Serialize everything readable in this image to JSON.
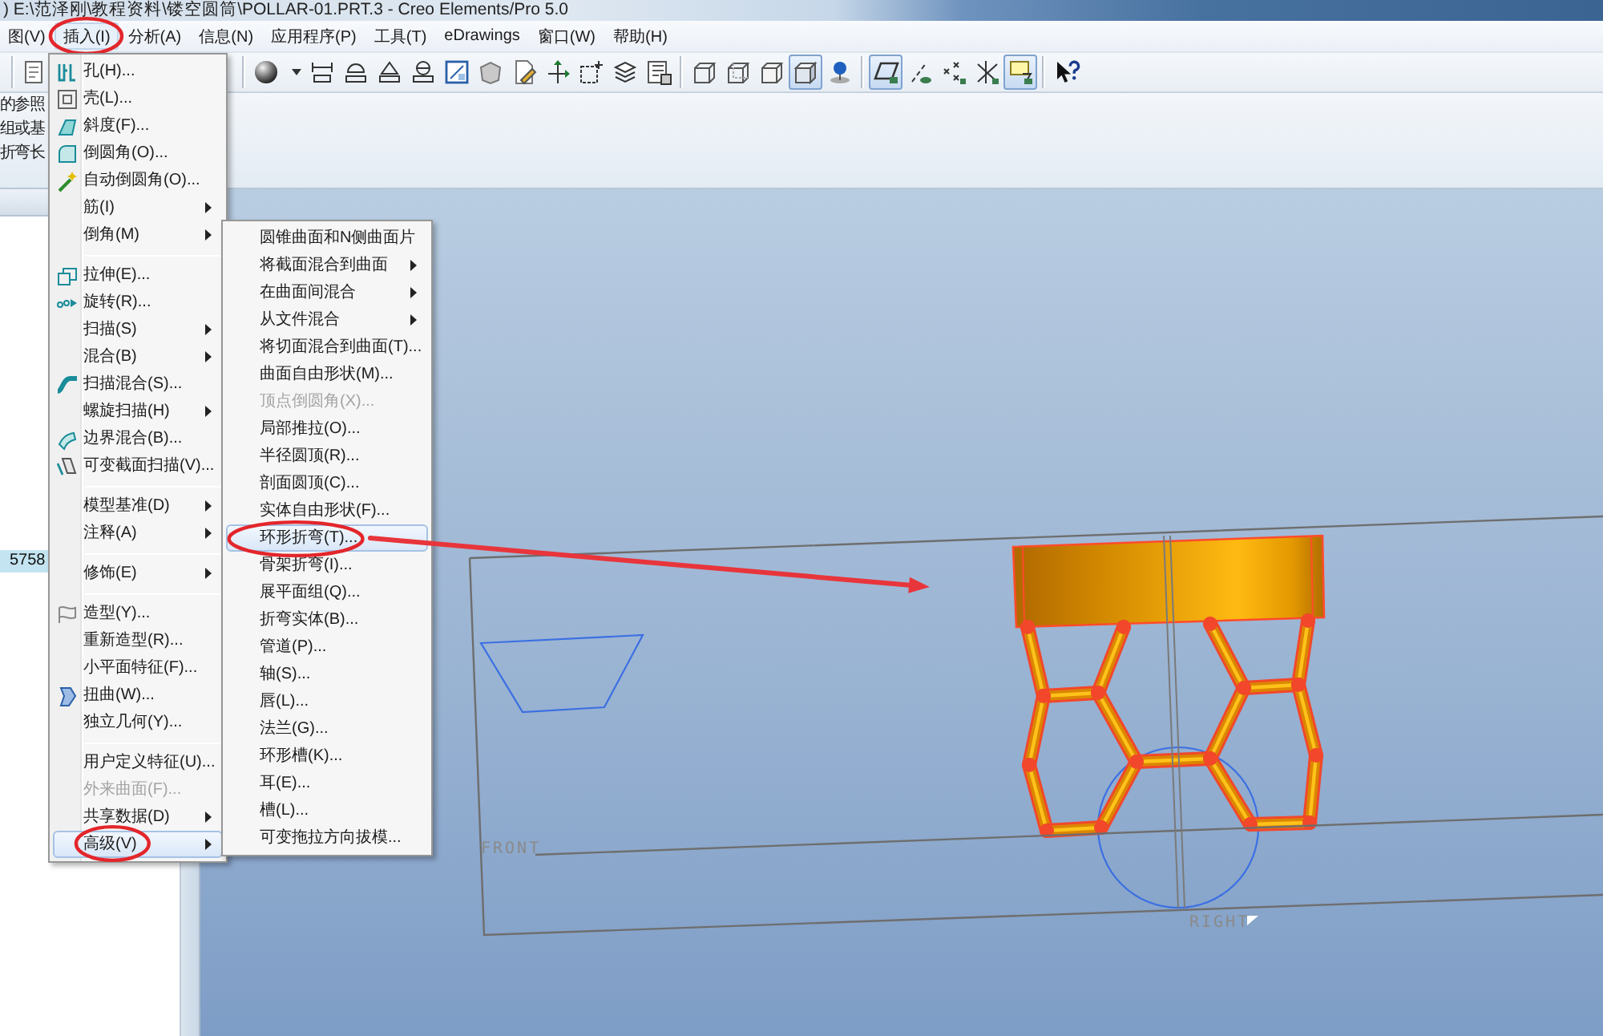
{
  "window": {
    "title": ") E:\\范泽刚\\教程资料\\镂空圆筒\\POLLAR-01.PRT.3 - Creo Elements/Pro 5.0"
  },
  "menu_bar": {
    "items": [
      {
        "label": "图(V)",
        "selected": false,
        "circled": false
      },
      {
        "label": "插入(I)",
        "selected": true,
        "circled": true
      },
      {
        "label": "分析(A)",
        "selected": false,
        "circled": false
      },
      {
        "label": "信息(N)",
        "selected": false,
        "circled": false
      },
      {
        "label": "应用程序(P)",
        "selected": false,
        "circled": false
      },
      {
        "label": "工具(T)",
        "selected": false,
        "circled": false
      },
      {
        "label": "eDrawings",
        "selected": false,
        "circled": false
      },
      {
        "label": "窗口(W)",
        "selected": false,
        "circled": false
      },
      {
        "label": "帮助(H)",
        "selected": false,
        "circled": false
      }
    ]
  },
  "toolbar": {
    "buttons": [
      {
        "on": false
      },
      {
        "on": false
      },
      {
        "on": false
      },
      {
        "on": false
      },
      {
        "on": false
      },
      {
        "on": false
      },
      {
        "on": false
      },
      {
        "on": false
      },
      {
        "on": false
      },
      {
        "on": false
      },
      {
        "on": false
      },
      {
        "on": false
      },
      {
        "on": false
      },
      {
        "on": false
      },
      {
        "on": false
      },
      {
        "on": false
      },
      {
        "on": true
      },
      {
        "on": false
      },
      {
        "on": true
      },
      {
        "on": false
      },
      {
        "on": false
      },
      {
        "on": false
      },
      {
        "on": true
      },
      {
        "on": false
      }
    ]
  },
  "message_area": {
    "lines": [
      "的参照",
      "组或基",
      "折弯长"
    ]
  },
  "model_tree": {
    "items": [
      {
        "label": "5758",
        "selected": true
      }
    ]
  },
  "insert_menu": {
    "groups": [
      [
        {
          "label": "孔(H)...",
          "submenu": false,
          "disabled": false,
          "selected": false,
          "circled": false
        },
        {
          "label": "壳(L)...",
          "submenu": false,
          "disabled": false,
          "selected": false,
          "circled": false
        },
        {
          "label": "斜度(F)...",
          "submenu": false,
          "disabled": false,
          "selected": false,
          "circled": false
        },
        {
          "label": "倒圆角(O)...",
          "submenu": false,
          "disabled": false,
          "selected": false,
          "circled": false
        },
        {
          "label": "自动倒圆角(O)...",
          "submenu": false,
          "disabled": false,
          "selected": false,
          "circled": false
        },
        {
          "label": "筋(I)",
          "submenu": true,
          "disabled": false,
          "selected": false,
          "circled": false
        },
        {
          "label": "倒角(M)",
          "submenu": true,
          "disabled": false,
          "selected": false,
          "circled": false
        }
      ],
      [
        {
          "label": "拉伸(E)...",
          "submenu": false,
          "disabled": false,
          "selected": false,
          "circled": false
        },
        {
          "label": "旋转(R)...",
          "submenu": false,
          "disabled": false,
          "selected": false,
          "circled": false
        },
        {
          "label": "扫描(S)",
          "submenu": true,
          "disabled": false,
          "selected": false,
          "circled": false
        },
        {
          "label": "混合(B)",
          "submenu": true,
          "disabled": false,
          "selected": false,
          "circled": false
        },
        {
          "label": "扫描混合(S)...",
          "submenu": false,
          "disabled": false,
          "selected": false,
          "circled": false
        },
        {
          "label": "螺旋扫描(H)",
          "submenu": true,
          "disabled": false,
          "selected": false,
          "circled": false
        },
        {
          "label": "边界混合(B)...",
          "submenu": false,
          "disabled": false,
          "selected": false,
          "circled": false
        },
        {
          "label": "可变截面扫描(V)...",
          "submenu": false,
          "disabled": false,
          "selected": false,
          "circled": false
        }
      ],
      [
        {
          "label": "模型基准(D)",
          "submenu": true,
          "disabled": false,
          "selected": false,
          "circled": false
        },
        {
          "label": "注释(A)",
          "submenu": true,
          "disabled": false,
          "selected": false,
          "circled": false
        }
      ],
      [
        {
          "label": "修饰(E)",
          "submenu": true,
          "disabled": false,
          "selected": false,
          "circled": false
        }
      ],
      [
        {
          "label": "造型(Y)...",
          "submenu": false,
          "disabled": false,
          "selected": false,
          "circled": false
        },
        {
          "label": "重新造型(R)...",
          "submenu": false,
          "disabled": false,
          "selected": false,
          "circled": false
        },
        {
          "label": "小平面特征(F)...",
          "submenu": false,
          "disabled": false,
          "selected": false,
          "circled": false
        },
        {
          "label": "扭曲(W)...",
          "submenu": false,
          "disabled": false,
          "selected": false,
          "circled": false
        },
        {
          "label": "独立几何(Y)...",
          "submenu": false,
          "disabled": false,
          "selected": false,
          "circled": false
        }
      ],
      [
        {
          "label": "用户定义特征(U)...",
          "submenu": false,
          "disabled": false,
          "selected": false,
          "circled": false
        },
        {
          "label": "外来曲面(F)...",
          "submenu": false,
          "disabled": true,
          "selected": false,
          "circled": false
        },
        {
          "label": "共享数据(D)",
          "submenu": true,
          "disabled": false,
          "selected": false,
          "circled": false
        },
        {
          "label": "高级(V)",
          "submenu": true,
          "disabled": false,
          "selected": true,
          "circled": true
        }
      ]
    ]
  },
  "advanced_submenu": {
    "items": [
      {
        "label": "圆锥曲面和N侧曲面片",
        "submenu": false,
        "disabled": false,
        "selected": false,
        "circled": false
      },
      {
        "label": "将截面混合到曲面",
        "submenu": true,
        "disabled": false,
        "selected": false,
        "circled": false
      },
      {
        "label": "在曲面间混合",
        "submenu": true,
        "disabled": false,
        "selected": false,
        "circled": false
      },
      {
        "label": "从文件混合",
        "submenu": true,
        "disabled": false,
        "selected": false,
        "circled": false
      },
      {
        "label": "将切面混合到曲面(T)...",
        "submenu": false,
        "disabled": false,
        "selected": false,
        "circled": false
      },
      {
        "label": "曲面自由形状(M)...",
        "submenu": false,
        "disabled": false,
        "selected": false,
        "circled": false
      },
      {
        "label": "顶点倒圆角(X)...",
        "submenu": false,
        "disabled": true,
        "selected": false,
        "circled": false
      },
      {
        "label": "局部推拉(O)...",
        "submenu": false,
        "disabled": false,
        "selected": false,
        "circled": false
      },
      {
        "label": "半径圆顶(R)...",
        "submenu": false,
        "disabled": false,
        "selected": false,
        "circled": false
      },
      {
        "label": "剖面圆顶(C)...",
        "submenu": false,
        "disabled": false,
        "selected": false,
        "circled": false
      },
      {
        "label": "实体自由形状(F)...",
        "submenu": false,
        "disabled": false,
        "selected": false,
        "circled": false
      },
      {
        "label": "环形折弯(T)...",
        "submenu": false,
        "disabled": false,
        "selected": true,
        "circled": true
      },
      {
        "label": "骨架折弯(I)...",
        "submenu": false,
        "disabled": false,
        "selected": false,
        "circled": false
      },
      {
        "label": "展平面组(Q)...",
        "submenu": false,
        "disabled": false,
        "selected": false,
        "circled": false
      },
      {
        "label": "折弯实体(B)...",
        "submenu": false,
        "disabled": false,
        "selected": false,
        "circled": false
      },
      {
        "label": "管道(P)...",
        "submenu": false,
        "disabled": false,
        "selected": false,
        "circled": false
      },
      {
        "label": "轴(S)...",
        "submenu": false,
        "disabled": false,
        "selected": false,
        "circled": false
      },
      {
        "label": "唇(L)...",
        "submenu": false,
        "disabled": false,
        "selected": false,
        "circled": false
      },
      {
        "label": "法兰(G)...",
        "submenu": false,
        "disabled": false,
        "selected": false,
        "circled": false
      },
      {
        "label": "环形槽(K)...",
        "submenu": false,
        "disabled": false,
        "selected": false,
        "circled": false
      },
      {
        "label": "耳(E)...",
        "submenu": false,
        "disabled": false,
        "selected": false,
        "circled": false
      },
      {
        "label": "槽(L)...",
        "submenu": false,
        "disabled": false,
        "selected": false,
        "circled": false
      },
      {
        "label": "可变拖拉方向拔模...",
        "submenu": false,
        "disabled": false,
        "selected": false,
        "circled": false
      }
    ]
  },
  "viewport": {
    "datum_planes": [
      {
        "label": "FRONT"
      },
      {
        "label": "RIGHT"
      }
    ]
  }
}
